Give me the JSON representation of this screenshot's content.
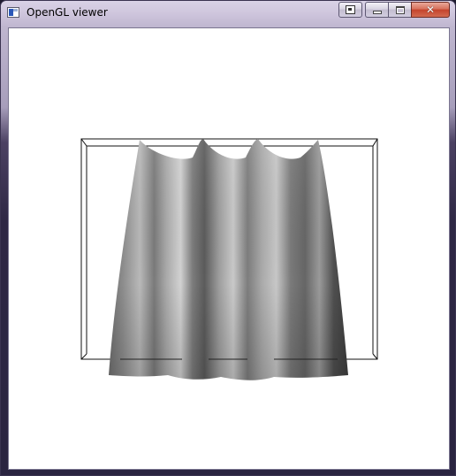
{
  "window": {
    "title": "OpenGL viewer",
    "app_icon": "opengl-window-icon"
  },
  "caption_buttons": {
    "extra": "pin-icon",
    "minimize": "minimize-icon",
    "maximize": "maximize-icon",
    "close": "close-icon",
    "close_glyph": "✕"
  },
  "viewport": {
    "content": "cloth-simulation-render",
    "background": "#ffffff",
    "cloth_color": "#9a9a9a",
    "frame_color": "#000000"
  }
}
